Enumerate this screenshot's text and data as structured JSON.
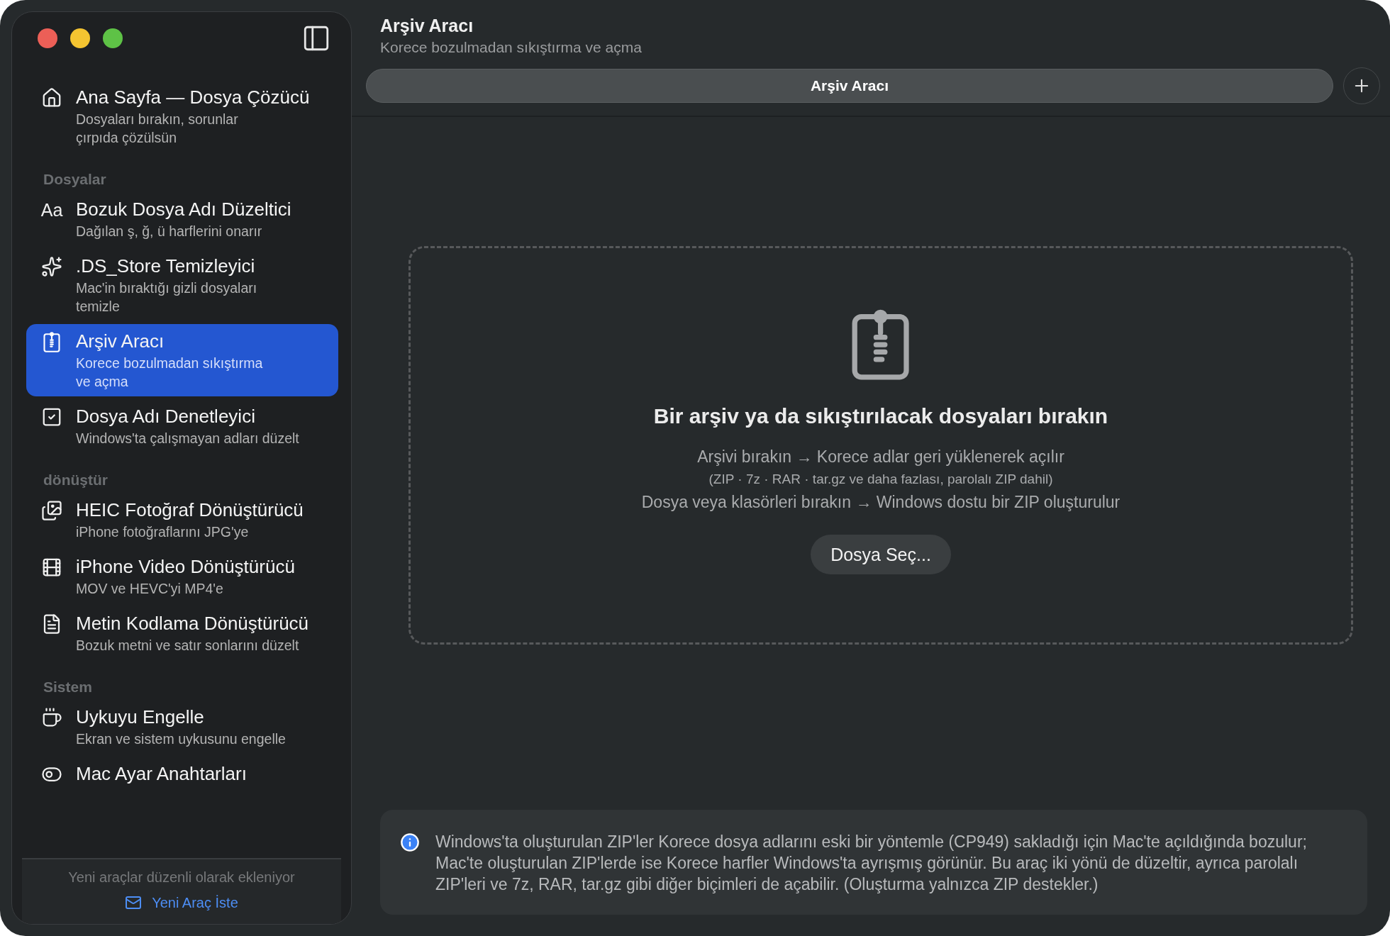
{
  "sidebar": {
    "home": {
      "title": "Ana Sayfa — Dosya Çözücü",
      "subtitle": "Dosyaları bırakın, sorunlar çırpıda çözülsün",
      "selected": false
    },
    "groups": [
      {
        "heading": "Dosyalar",
        "items": [
          {
            "icon_text": "Aa",
            "title": "Bozuk Dosya Adı Düzeltici",
            "subtitle": "Dağılan ş, ğ, ü harflerini onarır",
            "selected": false
          },
          {
            "title": ".DS_Store Temizleyici",
            "subtitle": "Mac'in bıraktığı gizli dosyaları temizle",
            "selected": false
          },
          {
            "title": "Arşiv Aracı",
            "subtitle": "Korece bozulmadan sıkıştırma ve açma",
            "selected": true
          },
          {
            "title": "Dosya Adı Denetleyici",
            "subtitle": "Windows'ta çalışmayan adları düzelt",
            "selected": false
          }
        ]
      },
      {
        "heading": "dönüştür",
        "items": [
          {
            "title": "HEIC Fotoğraf Dönüştürücü",
            "subtitle": "iPhone fotoğraflarını JPG'ye",
            "selected": false
          },
          {
            "title": "iPhone Video Dönüştürücü",
            "subtitle": "MOV ve HEVC'yi MP4'e",
            "selected": false
          },
          {
            "title": "Metin Kodlama Dönüştürücü",
            "subtitle": "Bozuk metni ve satır sonlarını düzelt",
            "selected": false
          }
        ]
      },
      {
        "heading": "Sistem",
        "items": [
          {
            "title": "Uykuyu Engelle",
            "subtitle": "Ekran ve sistem uykusunu engelle",
            "selected": false
          },
          {
            "title": "Mac Ayar Anahtarları",
            "selected": false
          }
        ]
      }
    ],
    "footer": {
      "note": "Yeni araçlar düzenli olarak ekleniyor",
      "link": "Yeni Araç İste"
    }
  },
  "header": {
    "title": "Arşiv Aracı",
    "subtitle": "Korece bozulmadan sıkıştırma ve açma"
  },
  "tabs": [
    {
      "label": "Arşiv Aracı",
      "selected": true
    }
  ],
  "drop_zone": {
    "heading": "Bir arşiv ya da sıkıştırılacak dosyaları bırakın",
    "lines": [
      {
        "kind": "main",
        "text": "Arşivi bırakın → Korece adlar geri yüklenerek açılır"
      },
      {
        "kind": "note",
        "text": "(ZIP · 7z · RAR · tar.gz ve daha fazlası, parolalı ZIP dahil)"
      },
      {
        "kind": "main",
        "text": "Dosya veya klasörleri bırakın → Windows dostu bir ZIP oluşturulur"
      }
    ],
    "button": "Dosya Seç..."
  },
  "info": {
    "text": "Windows'ta oluşturulan ZIP'ler Korece dosya adlarını eski bir yöntemle (CP949) sakladığı için Mac'te açıldığında bozulur; Mac'te oluşturulan ZIP'lerde ise Korece harfler Windows'ta ayrışmış görünür. Bu araç iki yönü de düzeltir, ayrıca parolalı ZIP'leri ve 7z, RAR, tar.gz gibi diğer biçimleri de açabilir. (Oluşturma yalnızca ZIP destekler.)"
  }
}
